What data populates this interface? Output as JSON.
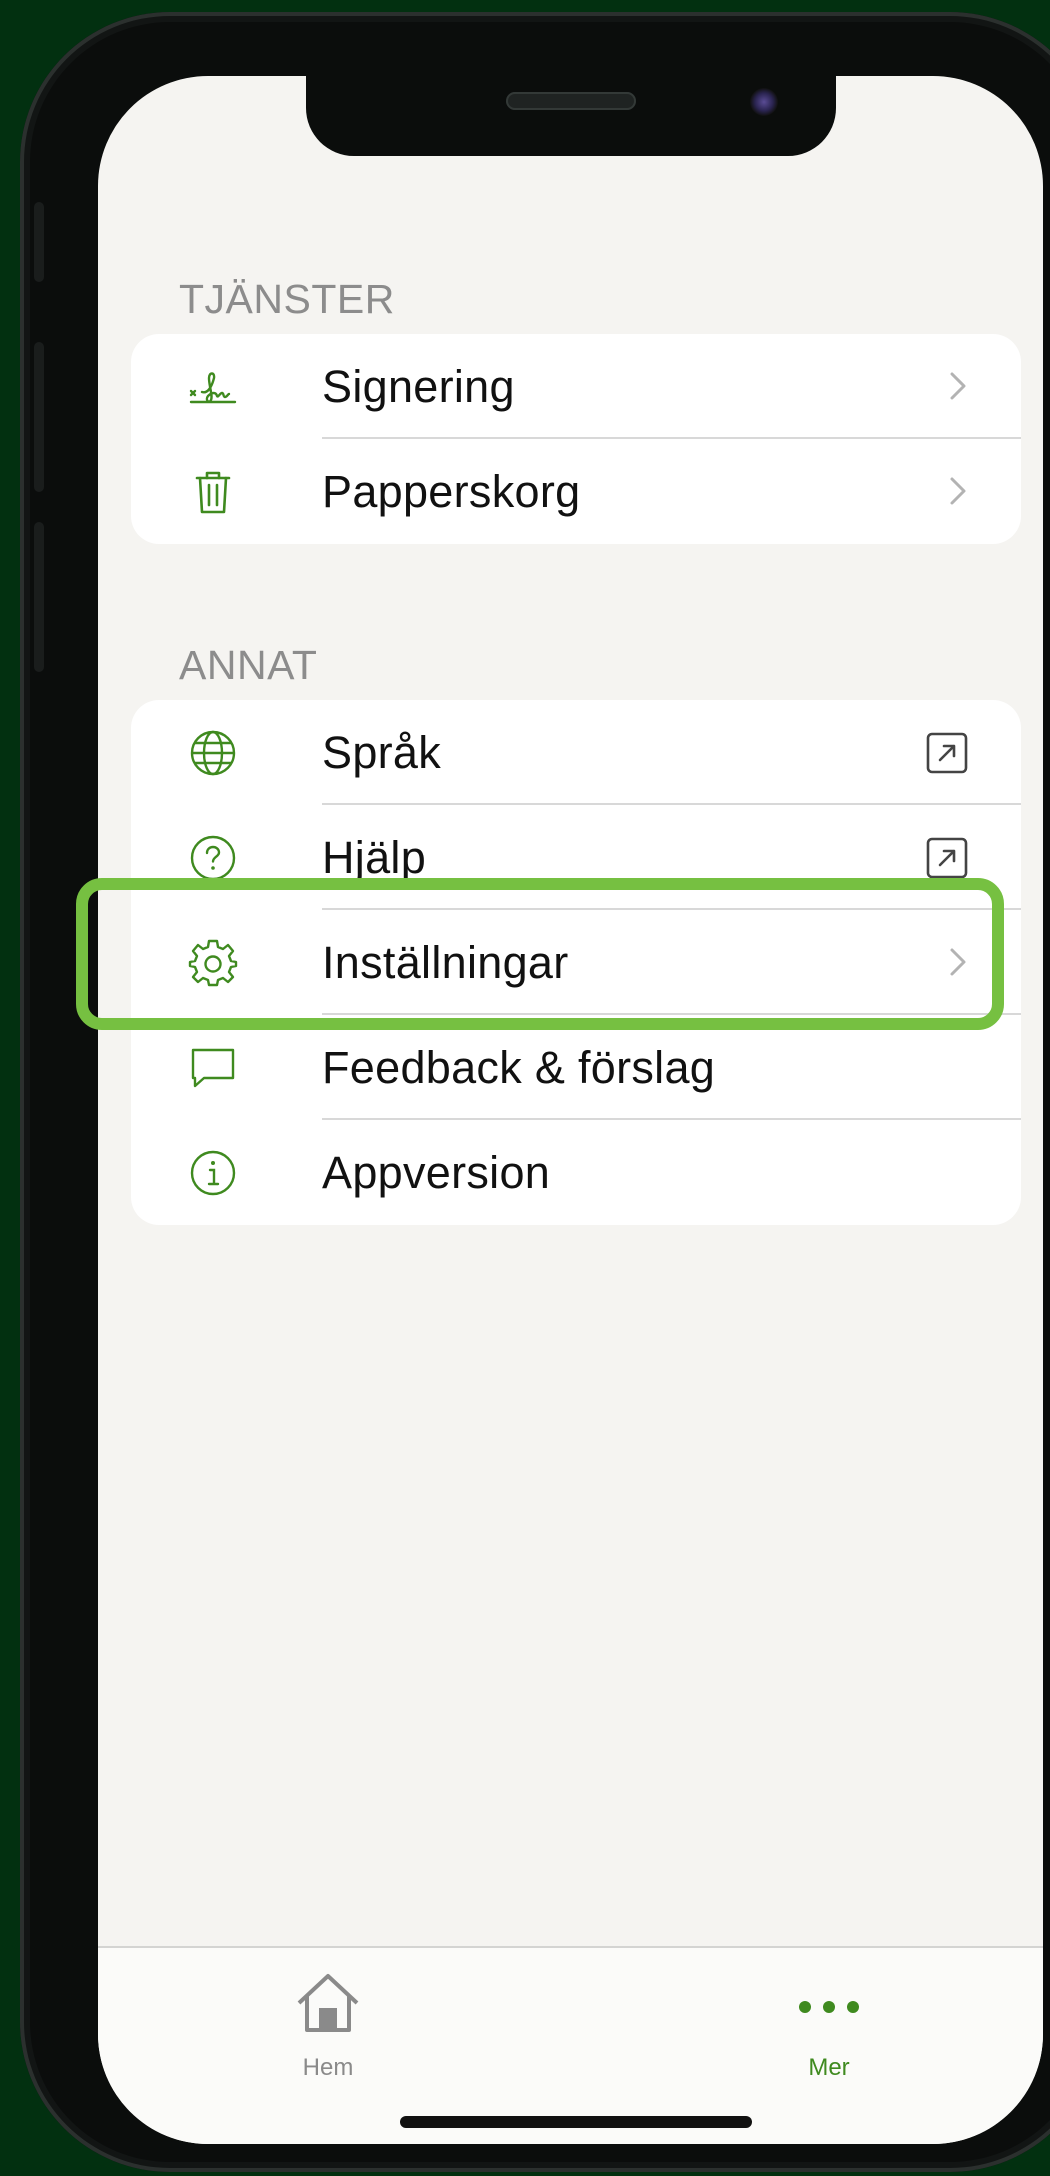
{
  "sections": [
    {
      "header": "TJÄNSTER",
      "items": [
        {
          "label": "Signering",
          "icon": "signature-icon",
          "accessory": "chevron"
        },
        {
          "label": "Papperskorg",
          "icon": "trash-icon",
          "accessory": "chevron"
        }
      ]
    },
    {
      "header": "ANNAT",
      "items": [
        {
          "label": "Språk",
          "icon": "globe-icon",
          "accessory": "external-link"
        },
        {
          "label": "Hjälp",
          "icon": "help-circle-icon",
          "accessory": "external-link"
        },
        {
          "label": "Inställningar",
          "icon": "gear-icon",
          "accessory": "chevron",
          "highlighted": true
        },
        {
          "label": "Feedback & förslag",
          "icon": "chat-bubble-icon",
          "accessory": "none"
        },
        {
          "label": "Appversion",
          "icon": "info-icon",
          "accessory": "none"
        }
      ]
    }
  ],
  "tabbar": {
    "tabs": [
      {
        "label": "Hem",
        "icon": "home-icon",
        "active": false
      },
      {
        "label": "Mer",
        "icon": "more-dots-icon",
        "active": true
      }
    ]
  },
  "colors": {
    "accent": "#3f8a1f",
    "highlight": "#76c041",
    "background": "#023010",
    "inactive_tab": "#8a8a8a"
  }
}
